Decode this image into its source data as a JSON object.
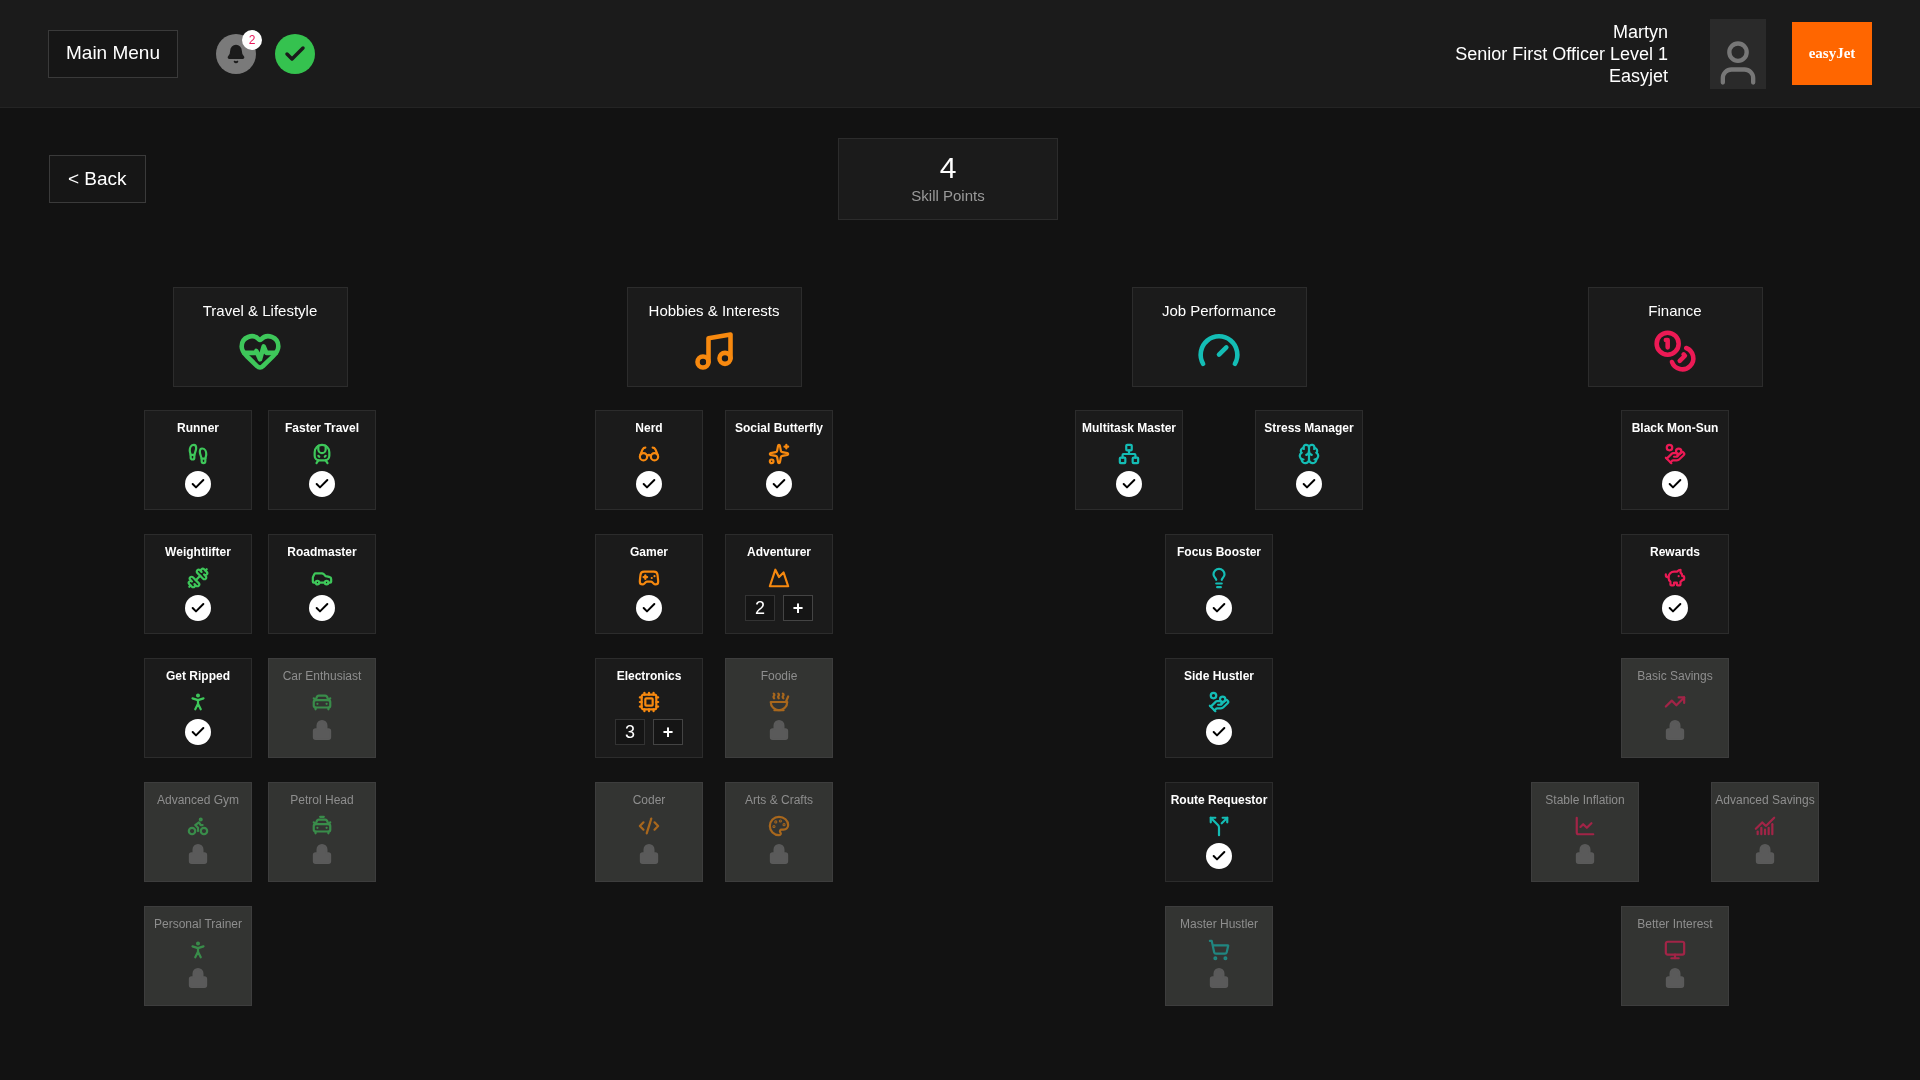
{
  "header": {
    "menu_button": "Main Menu",
    "notification_count": "2",
    "user": {
      "name": "Martyn",
      "rank": "Senior First Officer Level 1",
      "airline": "Easyjet"
    },
    "logo": "easyJet"
  },
  "back_button": "< Back",
  "skill_points": {
    "value": "4",
    "label": "Skill Points"
  },
  "categories": [
    {
      "title": "Travel & Lifestyle",
      "color": "#3ec75a",
      "rows": [
        [
          {
            "name": "Runner",
            "kind": "owned"
          },
          {
            "name": "Faster Travel",
            "kind": "owned"
          }
        ],
        [
          {
            "name": "Weightlifter",
            "kind": "owned"
          },
          {
            "name": "Roadmaster",
            "kind": "owned"
          }
        ],
        [
          {
            "name": "Get Ripped",
            "kind": "owned"
          },
          {
            "name": "Car Enthusiast",
            "kind": "locked"
          }
        ],
        [
          {
            "name": "Advanced Gym",
            "kind": "locked"
          },
          {
            "name": "Petrol Head",
            "kind": "locked"
          }
        ],
        [
          {
            "name": "Personal Trainer",
            "kind": "locked"
          }
        ]
      ]
    },
    {
      "title": "Hobbies & Interests",
      "color": "#f7890f",
      "rows": [
        [
          {
            "name": "Nerd",
            "kind": "owned"
          },
          {
            "name": "Social Butterfly",
            "kind": "owned"
          }
        ],
        [
          {
            "name": "Gamer",
            "kind": "owned"
          },
          {
            "name": "Adventurer",
            "kind": "levelling",
            "value": "2",
            "add_button": "+"
          }
        ],
        [
          {
            "name": "Electronics",
            "kind": "levelling",
            "value": "3",
            "add_button": "+"
          },
          {
            "name": "Foodie",
            "kind": "locked"
          }
        ],
        [
          {
            "name": "Coder",
            "kind": "locked"
          },
          {
            "name": "Arts & Crafts",
            "kind": "locked"
          }
        ]
      ]
    },
    {
      "title": "Job Performance",
      "color": "#14bdb5",
      "rows": [
        [
          {
            "name": "Multitask Master",
            "kind": "owned"
          },
          {
            "name": "Stress Manager",
            "kind": "owned"
          }
        ],
        [
          {
            "name": "Focus Booster",
            "kind": "owned"
          }
        ],
        [
          {
            "name": "Side Hustler",
            "kind": "owned"
          }
        ],
        [
          {
            "name": "Route Requestor",
            "kind": "owned"
          }
        ],
        [
          {
            "name": "Master Hustler",
            "kind": "locked"
          }
        ]
      ]
    },
    {
      "title": "Finance",
      "color": "#ec1a55",
      "rows": [
        [
          {
            "name": "Black Mon-Sun",
            "kind": "owned"
          }
        ],
        [
          {
            "name": "Rewards",
            "kind": "owned"
          }
        ],
        [
          {
            "name": "Basic Savings",
            "kind": "locked"
          }
        ],
        [
          {
            "name": "Stable Inflation",
            "kind": "locked"
          },
          {
            "name": "Advanced Savings",
            "kind": "locked"
          }
        ],
        [
          {
            "name": "Better Interest",
            "kind": "locked"
          }
        ]
      ]
    }
  ]
}
